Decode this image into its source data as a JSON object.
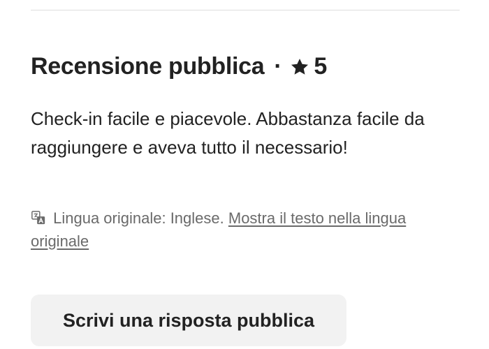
{
  "review": {
    "title": "Recensione pubblica",
    "separator": "·",
    "rating": "5",
    "text": "Check-in facile e piacevole. Abbastanza facile da raggiungere e aveva tutto il necessario!",
    "original_language_label": "Lingua originale: Inglese.",
    "show_original_link": "Mostra il testo nella lingua originale"
  },
  "actions": {
    "reply_button_label": "Scrivi una risposta pubblica"
  },
  "icons": {
    "rating": "star-icon",
    "language": "translate-icon"
  }
}
